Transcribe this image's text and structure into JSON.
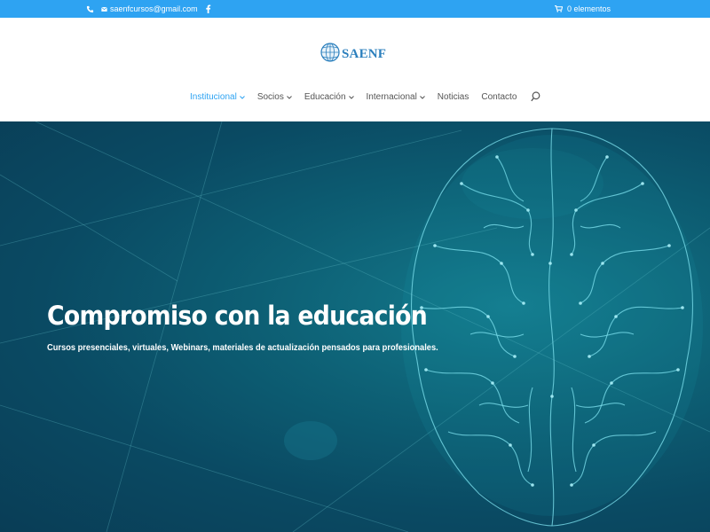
{
  "topbar": {
    "email": "saenfcursos@gmail.com",
    "cart_label": "0 elementos",
    "icons": [
      "phone-icon",
      "envelope-icon",
      "facebook-icon",
      "cart-icon"
    ]
  },
  "header": {
    "logo_text": "SAENF"
  },
  "nav": {
    "items": [
      {
        "label": "Institucional",
        "has_dropdown": true,
        "active": true
      },
      {
        "label": "Socios",
        "has_dropdown": true,
        "active": false
      },
      {
        "label": "Educación",
        "has_dropdown": true,
        "active": false
      },
      {
        "label": "Internacional",
        "has_dropdown": true,
        "active": false
      },
      {
        "label": "Noticias",
        "has_dropdown": false,
        "active": false
      },
      {
        "label": "Contacto",
        "has_dropdown": false,
        "active": false
      }
    ]
  },
  "hero": {
    "title": "Compromiso con la educación",
    "subtitle": "Cursos presenciales, virtuales, Webinars, materiales de actualización pensados para profesionales."
  },
  "colors": {
    "accent": "#2ea3f2",
    "logo": "#2b7fbd",
    "nav_text": "#555555",
    "hero_bg": "#0b5a70",
    "brain_lines": "#7fe3f0"
  }
}
